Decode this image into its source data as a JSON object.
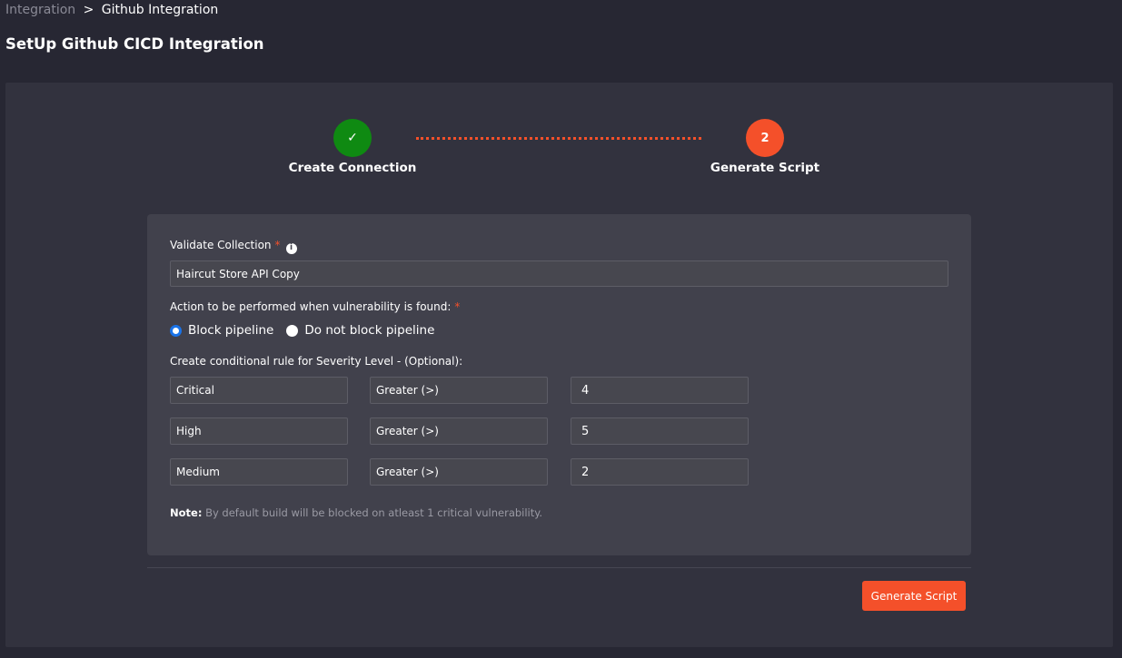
{
  "breadcrumb": {
    "parent": "Integration",
    "separator": ">",
    "current": "Github Integration"
  },
  "page_title": "SetUp Github CICD Integration",
  "stepper": {
    "steps": [
      {
        "indicator": "✓",
        "label": "Create Connection",
        "state": "done"
      },
      {
        "indicator": "2",
        "label": "Generate Script",
        "state": "active"
      }
    ]
  },
  "form": {
    "collection": {
      "label": "Validate Collection",
      "required_mark": "*",
      "info_icon": "i",
      "value": "Haircut Store API Copy"
    },
    "action": {
      "label": "Action to be performed when vulnerability is found:",
      "required_mark": "*",
      "options": [
        {
          "label": "Block pipeline",
          "checked": true
        },
        {
          "label": "Do not block pipeline",
          "checked": false
        }
      ]
    },
    "rules": {
      "label": "Create conditional rule for Severity Level - (Optional):",
      "rows": [
        {
          "severity": "Critical",
          "operator": "Greater (>)",
          "value": "4"
        },
        {
          "severity": "High",
          "operator": "Greater (>)",
          "value": "5"
        },
        {
          "severity": "Medium",
          "operator": "Greater (>)",
          "value": "2"
        }
      ]
    },
    "note": {
      "key": "Note:",
      "text": "By default build will be blocked on atleast 1 critical vulnerability."
    }
  },
  "footer": {
    "generate_button": "Generate Script"
  },
  "colors": {
    "accent": "#f4502a",
    "success": "#0f8a12",
    "radio_selected": "#1a73e8"
  }
}
